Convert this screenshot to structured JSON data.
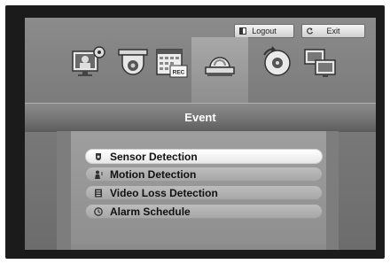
{
  "topbar": {
    "logout_label": "Logout",
    "exit_label": "Exit"
  },
  "icons": [
    {
      "name": "monitor-settings-icon"
    },
    {
      "name": "camera-dome-icon"
    },
    {
      "name": "record-schedule-icon",
      "badge": "REC"
    },
    {
      "name": "event-siren-icon",
      "selected": true
    },
    {
      "name": "backup-disc-icon"
    },
    {
      "name": "network-monitor-icon"
    }
  ],
  "title": "Event",
  "menu": [
    {
      "label": "Sensor Detection",
      "icon": "sensor-icon",
      "selected": true
    },
    {
      "label": "Motion Detection",
      "icon": "motion-icon"
    },
    {
      "label": "Video Loss Detection",
      "icon": "video-loss-icon"
    },
    {
      "label": "Alarm Schedule",
      "icon": "clock-icon"
    }
  ],
  "colors": {
    "bezel": "#1b1b1b",
    "screen_bg": "#7a7a7a",
    "selected_item": "#ffffff",
    "item": "#b2b2b2"
  }
}
